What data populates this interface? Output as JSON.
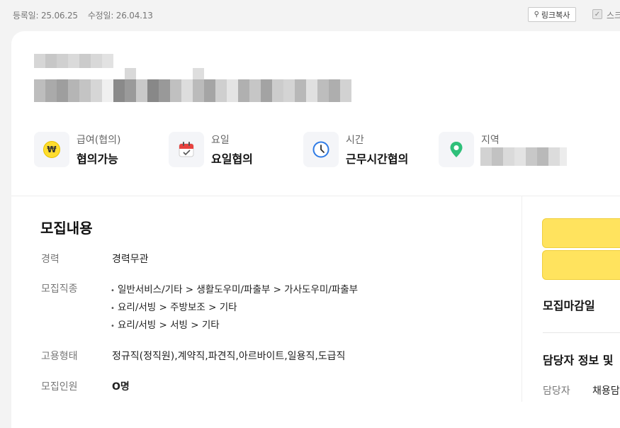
{
  "header": {
    "registered": "등록일: 25.06.25",
    "modified": "수정일: 26.04.13",
    "copy_link_label": "링크복사",
    "scrap_label": "스크랩"
  },
  "summary": [
    {
      "label": "급여(협의)",
      "value": "협의가능",
      "icon": "won-coin-icon"
    },
    {
      "label": "요일",
      "value": "요일협의",
      "icon": "calendar-icon"
    },
    {
      "label": "시간",
      "value": "근무시간협의",
      "icon": "clock-icon"
    },
    {
      "label": "지역",
      "value": "",
      "icon": "location-pin-icon"
    }
  ],
  "recruit": {
    "title": "모집내용",
    "career_label": "경력",
    "career_value": "경력무관",
    "jobs_label": "모집직종",
    "jobs": [
      "일반서비스/기타 > 생활도우미/파출부 > 가사도우미/파출부",
      "요리/서빙 > 주방보조 > 기타",
      "요리/서빙 > 서빙 > 기타"
    ],
    "employment_label": "고용형태",
    "employment_value": "정규직(정직원),계약직,파견직,아르바이트,일용직,도급직",
    "headcount_label": "모집인원",
    "headcount_value": "O명"
  },
  "sidebar": {
    "deadline_title": "모집마감일",
    "manager_title": "담당자 정보 및",
    "manager_label": "담당자",
    "manager_value": "채용담당자"
  },
  "colors": {
    "accent_yellow": "#ffe35e",
    "calendar_red": "#e8423f",
    "clock_blue": "#2f7be5",
    "pin_green": "#2fc07a"
  }
}
